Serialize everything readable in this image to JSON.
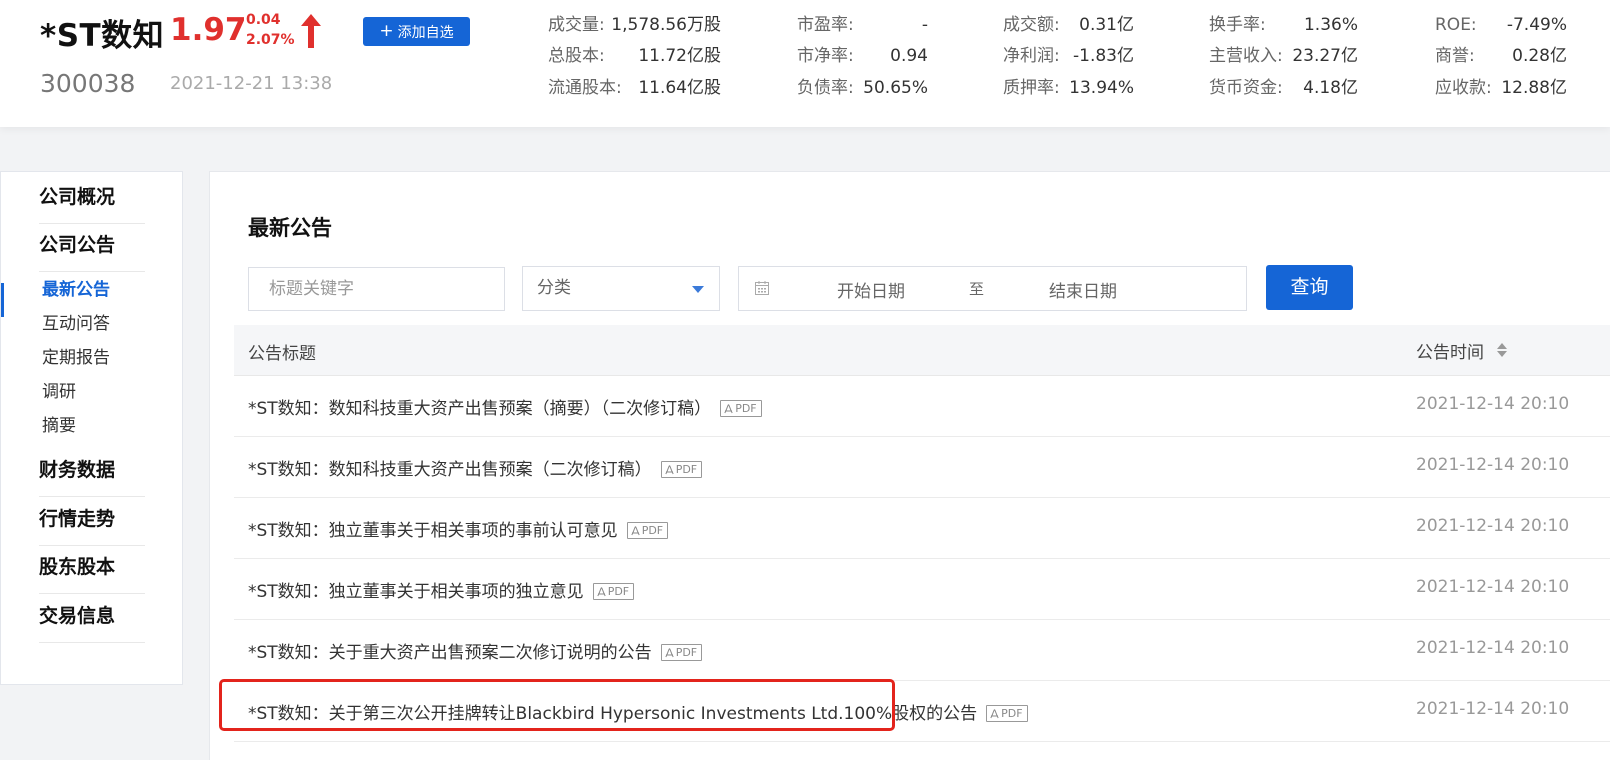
{
  "stock": {
    "name": "*ST数知",
    "price": "1.97",
    "change": "0.04",
    "change_pct": "2.07%",
    "code": "300038",
    "datetime": "2021-12-21 13:38",
    "add_watchlist_label": "添加自选",
    "trend": "up",
    "color_up": "#e0302d"
  },
  "metrics": [
    {
      "key": "成交量:",
      "value": "1,578.56万股"
    },
    {
      "key": "市盈率:",
      "value": "-"
    },
    {
      "key": "成交额:",
      "value": "0.31亿"
    },
    {
      "key": "换手率:",
      "value": "1.36%"
    },
    {
      "key": "ROE:",
      "value": "-7.49%"
    },
    {
      "key": "总股本:",
      "value": "11.72亿股"
    },
    {
      "key": "市净率:",
      "value": "0.94"
    },
    {
      "key": "净利润:",
      "value": "-1.83亿"
    },
    {
      "key": "主营收入:",
      "value": "23.27亿"
    },
    {
      "key": "商誉:",
      "value": "0.28亿"
    },
    {
      "key": "流通股本:",
      "value": "11.64亿股"
    },
    {
      "key": "负债率:",
      "value": "50.65%"
    },
    {
      "key": "质押率:",
      "value": "13.94%"
    },
    {
      "key": "货币资金:",
      "value": "4.18亿"
    },
    {
      "key": "应收款:",
      "value": "12.88亿"
    }
  ],
  "sidebar": {
    "sections": [
      {
        "label": "公司概况"
      },
      {
        "label": "公司公告"
      },
      {
        "label": "财务数据"
      },
      {
        "label": "行情走势"
      },
      {
        "label": "股东股本"
      },
      {
        "label": "交易信息"
      }
    ],
    "sub_items": [
      {
        "label": "最新公告",
        "active": true
      },
      {
        "label": "互动问答"
      },
      {
        "label": "定期报告"
      },
      {
        "label": "调研"
      },
      {
        "label": "摘要"
      }
    ]
  },
  "main": {
    "section_title": "最新公告",
    "search_placeholder": "标题关键字",
    "category_placeholder": "分类",
    "start_date_placeholder": "开始日期",
    "date_separator": "至",
    "end_date_placeholder": "结束日期",
    "query_label": "查询",
    "col_title": "公告标题",
    "col_time": "公告时间",
    "pdf_label": "PDF",
    "rows": [
      {
        "title": "*ST数知：数知科技重大资产出售预案（摘要）（二次修订稿）",
        "time": "2021-12-14 20:10"
      },
      {
        "title": "*ST数知：数知科技重大资产出售预案（二次修订稿）",
        "time": "2021-12-14 20:10"
      },
      {
        "title": "*ST数知：独立董事关于相关事项的事前认可意见",
        "time": "2021-12-14 20:10"
      },
      {
        "title": "*ST数知：独立董事关于相关事项的独立意见",
        "time": "2021-12-14 20:10"
      },
      {
        "title": "*ST数知：关于重大资产出售预案二次修订说明的公告",
        "time": "2021-12-14 20:10"
      },
      {
        "title": "*ST数知：关于第三次公开挂牌转让Blackbird Hypersonic Investments Ltd.100%股权的公告",
        "time": "2021-12-14 20:10"
      }
    ]
  },
  "colors": {
    "accent": "#1565d6",
    "highlight_box": "#e3241c"
  }
}
